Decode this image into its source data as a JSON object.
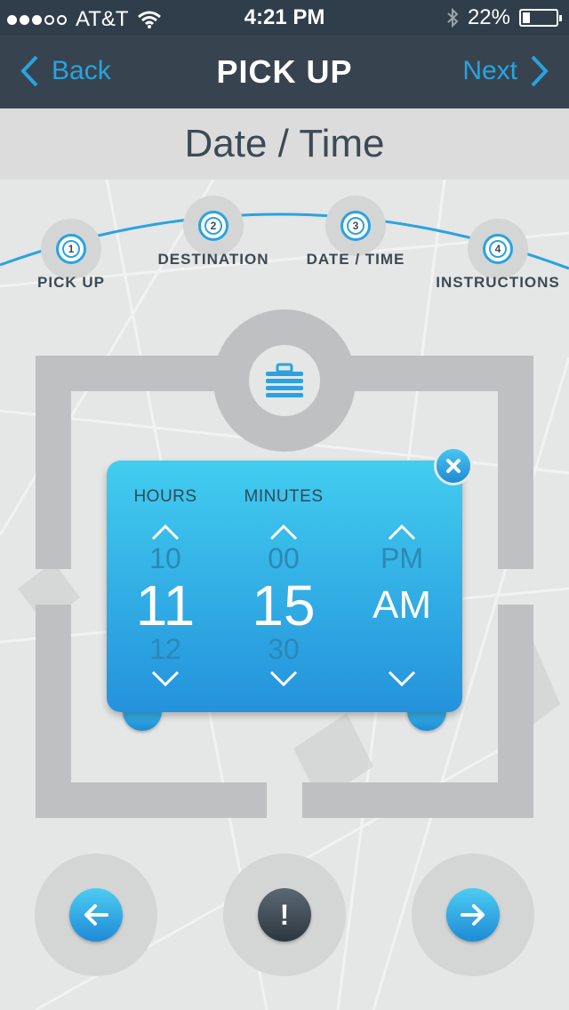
{
  "status": {
    "carrier": "AT&T",
    "time": "4:21 PM",
    "battery": "22%",
    "battery_level": 0.22,
    "signal_bars_filled": 3,
    "signal_bars_total": 5
  },
  "nav": {
    "back": "Back",
    "title": "PICK UP",
    "next": "Next"
  },
  "subtitle": "Date / Time",
  "steps": [
    {
      "num": "1",
      "label": "PICK UP"
    },
    {
      "num": "2",
      "label": "DESTINATION"
    },
    {
      "num": "3",
      "label": "DATE / TIME"
    },
    {
      "num": "4",
      "label": "INSTRUCTIONS"
    }
  ],
  "picker": {
    "hours": {
      "header": "HOURS",
      "prev": "10",
      "current": "11",
      "next": "12"
    },
    "minutes": {
      "header": "MINUTES",
      "prev": "00",
      "current": "15",
      "next": "30"
    },
    "period": {
      "prev": "PM",
      "current": "AM"
    }
  },
  "colors": {
    "accent": "#2aa3e0",
    "navbar": "#37444f",
    "statusbar": "#2f3e4a",
    "text": "#3c4a55"
  },
  "icons": {
    "center": "briefcase-icon",
    "close": "close-icon",
    "prev": "arrow-left-icon",
    "info": "exclamation-icon",
    "next": "arrow-right-icon"
  }
}
